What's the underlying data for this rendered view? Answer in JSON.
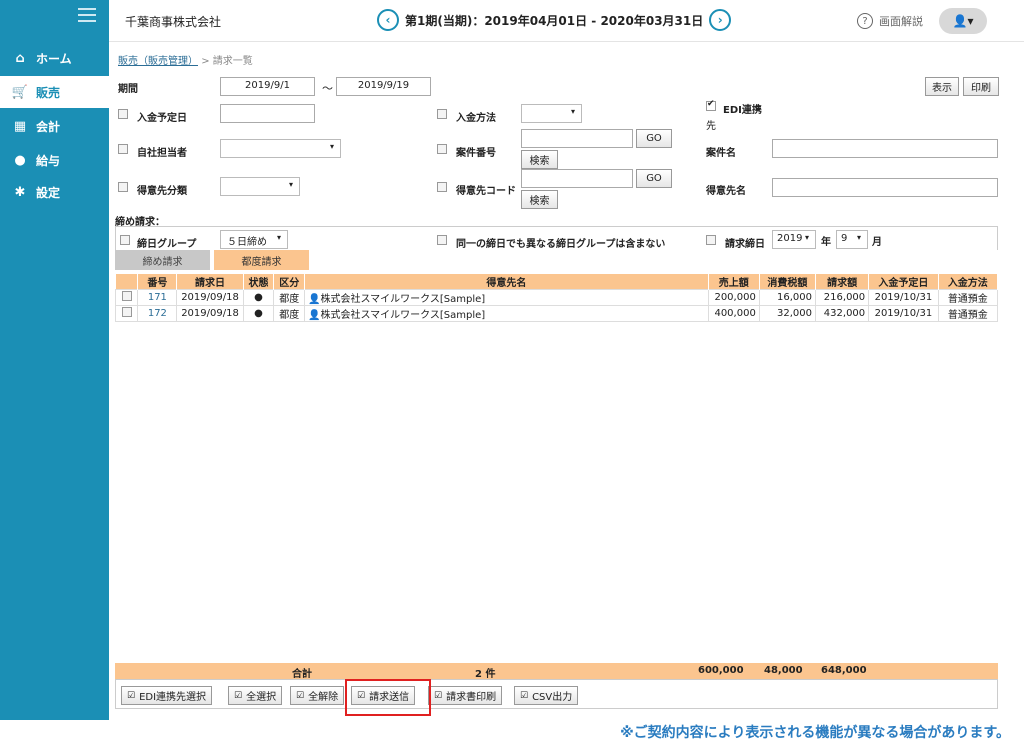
{
  "header": {
    "company": "千葉商事株式会社",
    "period": "第1期(当期)：2019年04月01日 - 2020年03月31日",
    "help": "画面解説"
  },
  "sidebar": {
    "items": [
      {
        "label": "ホーム",
        "icon": "home-icon"
      },
      {
        "label": "販売",
        "icon": "cart-icon"
      },
      {
        "label": "会計",
        "icon": "calculator-icon"
      },
      {
        "label": "給与",
        "icon": "money-bag-icon"
      },
      {
        "label": "設定",
        "icon": "gear-icon"
      }
    ],
    "active": "販売"
  },
  "breadcrumb": {
    "parent": "販売（販売管理）",
    "sep": ">",
    "current": "請求一覧"
  },
  "filters": {
    "period_label": "期間",
    "period_from": "2019/9/1",
    "tilde": "～",
    "period_to": "2019/9/19",
    "show_button": "表示",
    "print_button": "印刷",
    "due_date_label": "入金予定日",
    "payment_method_label": "入金方法",
    "edi_label": "EDI連携",
    "edi_label_2": "先",
    "staff_label": "自社担当者",
    "project_no_label": "案件番号",
    "project_name_label": "案件名",
    "customer_class_label": "得意先分類",
    "customer_code_label": "得意先コード",
    "customer_name_label": "得意先名",
    "go": "GO",
    "search": "検索",
    "closing_label": "締め請求：",
    "closing_group_label": "締日グループ",
    "closing_group_value": "５日締め",
    "exclude_label": "同一の締日でも異なる締日グループは含まない",
    "closing_day_label": "請求締日",
    "year_value": "2019",
    "year_unit": "年",
    "month_value": "9",
    "month_unit": "月"
  },
  "tabs": [
    {
      "label": "締め請求",
      "active": false
    },
    {
      "label": "都度請求",
      "active": true
    }
  ],
  "table": {
    "headers": [
      "番号",
      "請求日",
      "状態",
      "区分",
      "得意先名",
      "売上額",
      "消費税額",
      "請求額",
      "入金予定日",
      "入金方法"
    ],
    "rows": [
      {
        "no": "171",
        "date": "2019/09/18",
        "kind": "都度",
        "customer": "株式会社スマイルワークス[Sample]",
        "sales": "200,000",
        "tax": "16,000",
        "billed": "216,000",
        "due": "2019/10/31",
        "method": "普通預金"
      },
      {
        "no": "172",
        "date": "2019/09/18",
        "kind": "都度",
        "customer": "株式会社スマイルワークス[Sample]",
        "sales": "400,000",
        "tax": "32,000",
        "billed": "432,000",
        "due": "2019/10/31",
        "method": "普通預金"
      }
    ]
  },
  "totals": {
    "label": "合計",
    "count": "2 件",
    "sales": "600,000",
    "tax": "48,000",
    "billed": "648,000"
  },
  "actions": [
    "EDI連携先選択",
    "全選択",
    "全解除",
    "請求送信",
    "請求書印刷",
    "CSV出力"
  ],
  "notice": "※ご契約内容により表示される機能が異なる場合があります。"
}
